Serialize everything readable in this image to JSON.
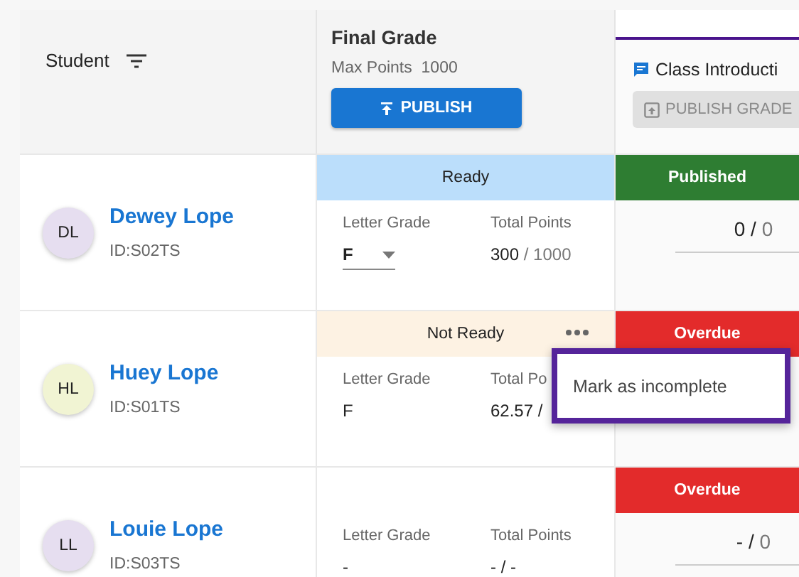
{
  "header": {
    "student_label": "Student",
    "final_grade": {
      "title": "Final Grade",
      "max_points_label": "Max Points",
      "max_points": "1000",
      "publish_button": "PUBLISH"
    },
    "assignment": {
      "title": "Class Introducti",
      "publish_button": "PUBLISH GRADE",
      "disabled": true
    }
  },
  "students": [
    {
      "initials": "DL",
      "color": "#e6def0",
      "name": "Dewey Lope",
      "id": "ID:S02TS",
      "final_status": {
        "kind": "ready",
        "label": "Ready"
      },
      "letter_label": "Letter Grade",
      "letter": "F",
      "letter_dropdown": true,
      "points_label": "Total Points",
      "points": "300",
      "points_max": "/ 1000",
      "assignment_status": {
        "kind": "published",
        "label": "Published"
      },
      "score": "0 /",
      "score_max": "0"
    },
    {
      "initials": "HL",
      "color": "#f1f4d3",
      "name": "Huey Lope",
      "id": "ID:S01TS",
      "final_status": {
        "kind": "not_ready",
        "label": "Not Ready"
      },
      "more_menu": true,
      "letter_label": "Letter Grade",
      "letter": "F",
      "letter_dropdown": false,
      "points_label": "Total Po",
      "points": "62.57 /",
      "assignment_status": {
        "kind": "overdue",
        "label": "Overdue"
      }
    },
    {
      "initials": "LL",
      "color": "#e6def0",
      "name": "Louie Lope",
      "id": "ID:S03TS",
      "final_status": {
        "kind": "none"
      },
      "letter_label": "Letter Grade",
      "letter": "-",
      "letter_dropdown": false,
      "points_label": "Total Points",
      "points": "- / -",
      "assignment_status": {
        "kind": "overdue",
        "label": "Overdue"
      },
      "score": "- /",
      "score_max": "0"
    }
  ],
  "popup_menu": {
    "items": [
      "Mark as incomplete"
    ]
  }
}
